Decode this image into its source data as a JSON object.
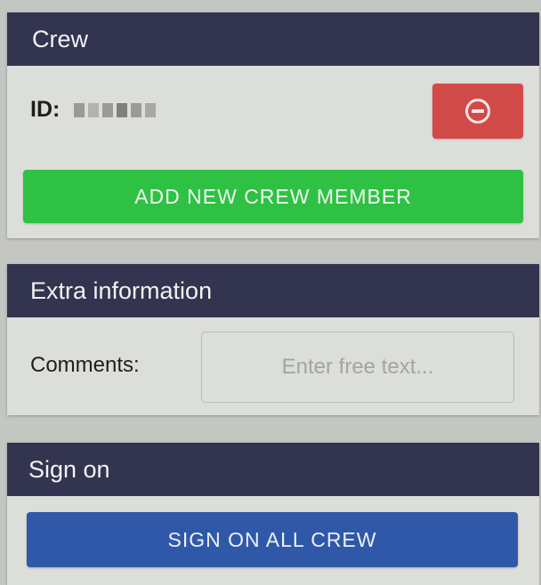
{
  "colors": {
    "header_bg": "#33344f",
    "panel_bg": "#dcdeda",
    "remove_button": "#d24a48",
    "add_button": "#2fc144",
    "signon_button": "#2f58a8"
  },
  "crew": {
    "header": "Crew",
    "id_label": "ID:",
    "remove_icon": "minus-circle-icon",
    "add_button_label": "ADD NEW CREW MEMBER"
  },
  "extra_info": {
    "header": "Extra information",
    "comments_label": "Comments:",
    "comments_value": "",
    "comments_placeholder": "Enter free text..."
  },
  "sign_on": {
    "header": "Sign on",
    "button_label": "SIGN ON ALL CREW"
  }
}
